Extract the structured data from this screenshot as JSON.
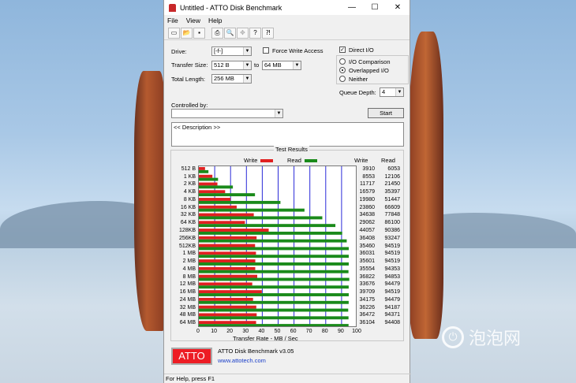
{
  "window": {
    "title": "Untitled - ATTO Disk Benchmark",
    "controls": {
      "minimize": "—",
      "maximize": "☐",
      "close": "✕"
    }
  },
  "menu": [
    "File",
    "View",
    "Help"
  ],
  "toolbar_icons": [
    "new-icon",
    "open-icon",
    "save-icon",
    "print-icon",
    "print-preview-icon",
    "move-icon",
    "help-icon",
    "context-help-icon"
  ],
  "form": {
    "drive_label": "Drive:",
    "drive_value": "[-f-]",
    "transfer_size_label": "Transfer Size:",
    "transfer_from": "512 B",
    "to_label": "to",
    "transfer_to": "64 MB",
    "total_length_label": "Total Length:",
    "total_length": "256 MB",
    "force_write_label": "Force Write Access",
    "direct_io_label": "Direct I/O",
    "io_comparison_label": "I/O Comparison",
    "overlapped_io_label": "Overlapped I/O",
    "neither_label": "Neither",
    "queue_depth_label": "Queue Depth:",
    "queue_depth": "4",
    "controlled_by_label": "Controlled by:",
    "controlled_by": "",
    "start_label": "Start",
    "description": "<< Description >>"
  },
  "results": {
    "title": "Test Results",
    "write_legend": "Write",
    "read_legend": "Read",
    "write_header": "Write",
    "read_header": "Read",
    "write_color": "#e02020",
    "read_color": "#1a8a1a"
  },
  "chart_data": {
    "type": "bar",
    "orientation": "horizontal",
    "title": "Test Results",
    "xlabel": "Transfer Rate - MB / Sec",
    "xlim": [
      0,
      100
    ],
    "xticks": [
      "0",
      "10",
      "20",
      "30",
      "40",
      "50",
      "60",
      "70",
      "80",
      "90",
      "100"
    ],
    "categories": [
      "512 B",
      "1 KB",
      "2 KB",
      "4 KB",
      "8 KB",
      "16 KB",
      "32 KB",
      "64 KB",
      "128KB",
      "256KB",
      "512KB",
      "1 MB",
      "2 MB",
      "4 MB",
      "8 MB",
      "12 MB",
      "16 MB",
      "24 MB",
      "32 MB",
      "48 MB",
      "64 MB"
    ],
    "series": [
      {
        "name": "Write",
        "values": [
          3910,
          8553,
          11717,
          16579,
          19980,
          23860,
          34638,
          29062,
          44057,
          36408,
          35460,
          36031,
          35601,
          35554,
          36822,
          33676,
          39709,
          34175,
          36226,
          36472,
          36104
        ]
      },
      {
        "name": "Read",
        "values": [
          6053,
          12106,
          21450,
          35397,
          51447,
          66609,
          77848,
          86100,
          90386,
          93247,
          94519,
          94519,
          94519,
          94353,
          94853,
          94479,
          94519,
          94479,
          94187,
          94371,
          94408
        ]
      }
    ],
    "grid": true,
    "legend": "top"
  },
  "branding": {
    "logo": "ATTO",
    "product": "ATTO Disk Benchmark v3.05",
    "url": "www.attotech.com"
  },
  "status_bar": "For Help, press F1",
  "watermark": "泡泡网"
}
